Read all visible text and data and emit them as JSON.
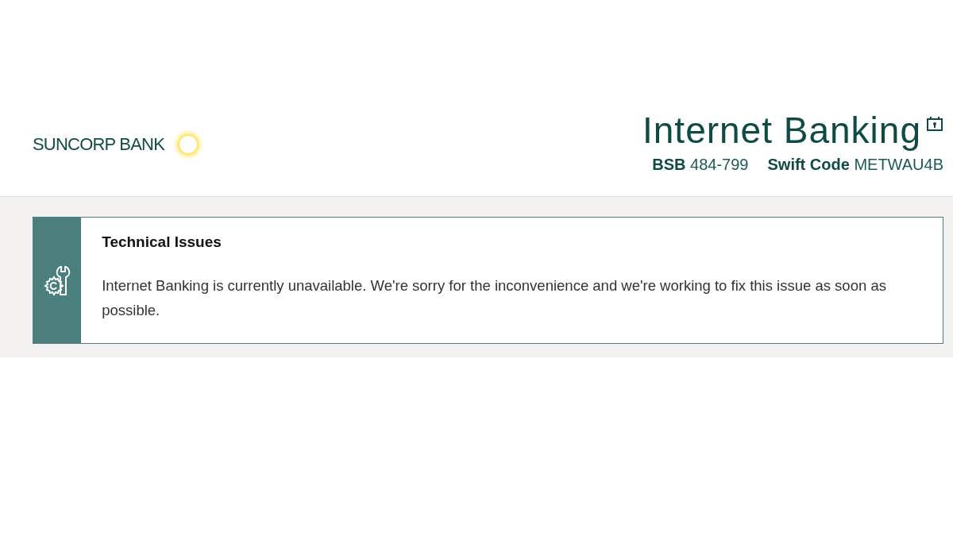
{
  "header": {
    "logo": "SUNCORP BANK",
    "title": "Internet Banking",
    "codes": [
      "**BSB** 484-799",
      "**Swift Code** METWAU4B"
    ]
  },
  "alert": {
    "title": "Technical Issues",
    "message": "Internet Banking is currently unavailable. We're sorry for the inconvenience and we're working to fix this issue as soon as possible."
  }
}
